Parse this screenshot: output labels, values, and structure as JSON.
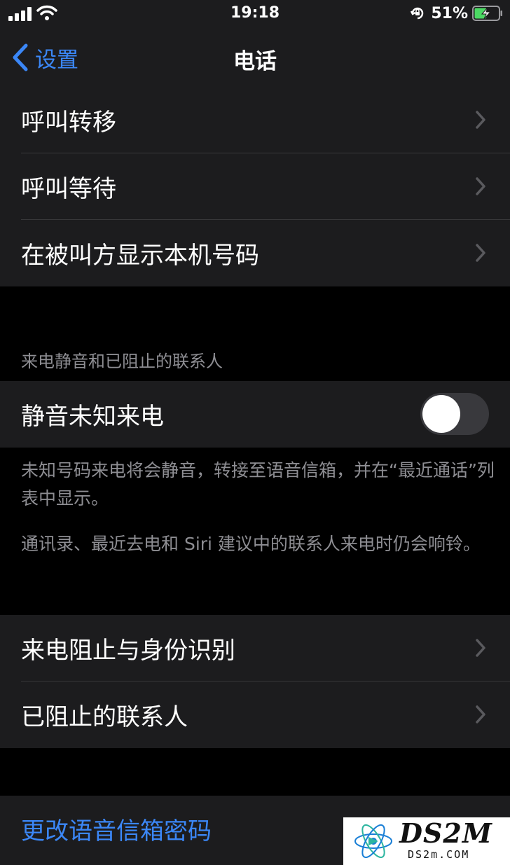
{
  "status_bar": {
    "time": "19:18",
    "battery_percent": "51%",
    "signal_icon": "cellular-signal-icon",
    "wifi_icon": "wifi-icon",
    "lock_icon": "orientation-lock-icon",
    "battery_icon": "battery-charging-icon",
    "battery_level": 0.51,
    "battery_color": "#4cd964"
  },
  "nav": {
    "back_label": "设置",
    "title": "电话",
    "accent_color": "#3b87f7"
  },
  "group1": {
    "items": [
      {
        "label": "呼叫转移"
      },
      {
        "label": "呼叫等待"
      },
      {
        "label": "在被叫方显示本机号码"
      }
    ]
  },
  "silence_section": {
    "header": "来电静音和已阻止的联系人",
    "toggle_label": "静音未知来电",
    "toggle_on": false,
    "footer_1": "未知号码来电将会静音，转接至语音信箱，并在“最近通话”列表中显示。",
    "footer_2": "通讯录、最近去电和 Siri 建议中的联系人来电时仍会响铃。"
  },
  "group2": {
    "items": [
      {
        "label": "来电阻止与身份识别"
      },
      {
        "label": "已阻止的联系人"
      }
    ]
  },
  "group3": {
    "link_label": "更改语音信箱密码"
  },
  "watermark": {
    "brand": "DS2M",
    "domain": "DS2m.COM"
  }
}
